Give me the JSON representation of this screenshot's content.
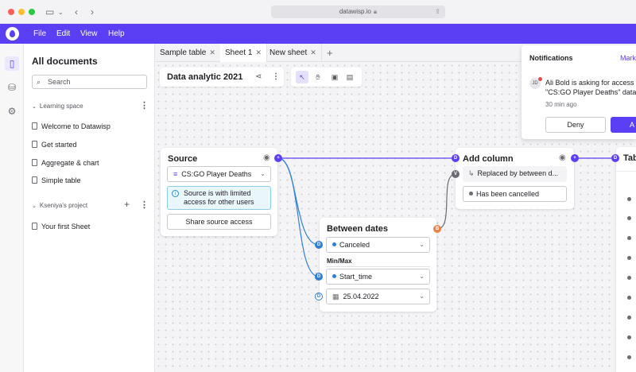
{
  "browser": {
    "url": "datawisp.io"
  },
  "menu": [
    "File",
    "Edit",
    "View",
    "Help"
  ],
  "sidebar": {
    "title": "All documents",
    "search_placeholder": "Search",
    "sections": [
      {
        "label": "Learning space",
        "items": [
          "Welcome to Datawisp",
          "Get started",
          "Aggregate & chart",
          "Simple table"
        ]
      },
      {
        "label": "Kseniya's project",
        "items": [
          "Your first Sheet"
        ]
      }
    ]
  },
  "tabs": [
    {
      "label": "Sample table",
      "active": false
    },
    {
      "label": "Sheet 1",
      "active": true
    },
    {
      "label": "New sheet",
      "active": false
    }
  ],
  "document": {
    "title": "Data analytic 2021"
  },
  "nodes": {
    "source": {
      "title": "Source",
      "table": "CS:GO Player Deaths",
      "info": "Source is with limited access for other users",
      "share_button": "Share source access"
    },
    "between_dates": {
      "title": "Between dates",
      "field1": "Canceled",
      "section": "Min/Max",
      "field2": "Start_time",
      "date": "25.04.2022",
      "port_d": "D",
      "port_b": "B"
    },
    "add_column": {
      "title": "Add column",
      "mode": "Replaced by between d...",
      "value": "Has been cancelled",
      "port_d": "D",
      "port_v": "V"
    },
    "table_node": {
      "title": "Tab",
      "port_d": "D"
    }
  },
  "notifications": {
    "title": "Notifications",
    "mark_all": "Mark",
    "item": {
      "initials": "JD",
      "message_line1": "Ali Bold is asking for access",
      "message_line2": "\"CS:GO Player Deaths\" data",
      "time": "30 min ago",
      "deny": "Deny",
      "accept": "A"
    }
  },
  "colors": {
    "accent": "#5b3ff5",
    "port_d": "#2f7fd6",
    "port_b": "#e8834a",
    "port_v": "#6b6b72",
    "link": "#2f7fd6"
  }
}
